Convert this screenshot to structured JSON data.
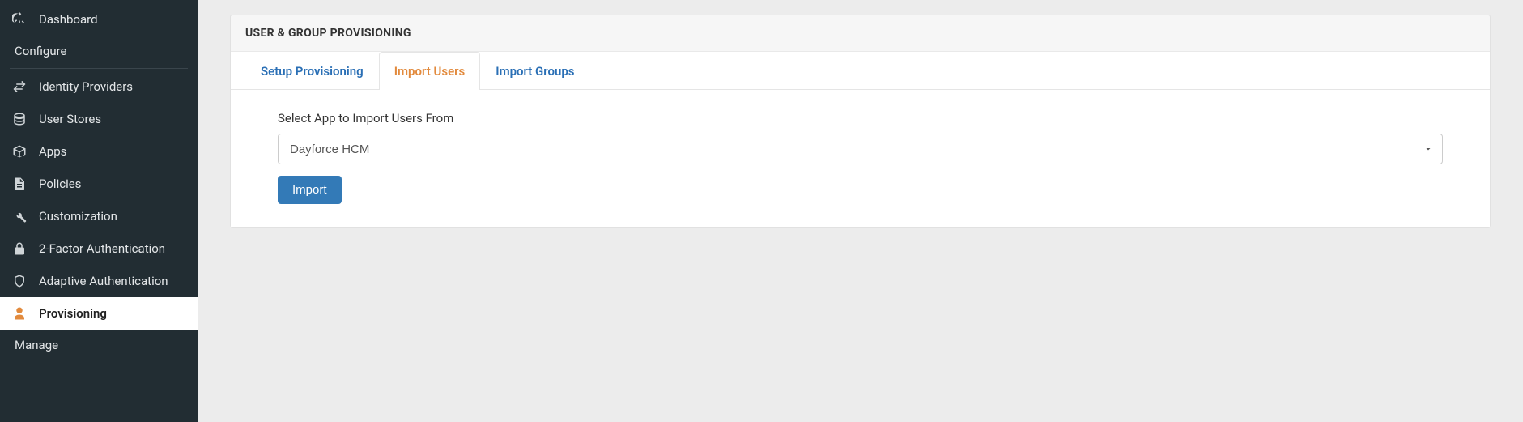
{
  "sidebar": {
    "items": [
      {
        "label": "Dashboard",
        "icon": "dashboard-icon",
        "active": false
      },
      {
        "section": "Configure"
      },
      {
        "label": "Identity Providers",
        "icon": "swap-icon",
        "active": false
      },
      {
        "label": "User Stores",
        "icon": "database-icon",
        "active": false
      },
      {
        "label": "Apps",
        "icon": "box-icon",
        "active": false
      },
      {
        "label": "Policies",
        "icon": "document-icon",
        "active": false
      },
      {
        "label": "Customization",
        "icon": "wrench-icon",
        "active": false
      },
      {
        "label": "2-Factor Authentication",
        "icon": "lock-icon",
        "active": false
      },
      {
        "label": "Adaptive Authentication",
        "icon": "shield-icon",
        "active": false
      },
      {
        "label": "Provisioning",
        "icon": "user-icon",
        "active": true
      },
      {
        "section": "Manage"
      }
    ]
  },
  "page": {
    "title": "USER & GROUP PROVISIONING"
  },
  "tabs": [
    {
      "label": "Setup Provisioning",
      "active": false
    },
    {
      "label": "Import Users",
      "active": true
    },
    {
      "label": "Import Groups",
      "active": false
    }
  ],
  "form": {
    "select_label": "Select App to Import Users From",
    "selected_value": "Dayforce HCM",
    "options": [
      "Dayforce HCM"
    ],
    "button_label": "Import"
  }
}
